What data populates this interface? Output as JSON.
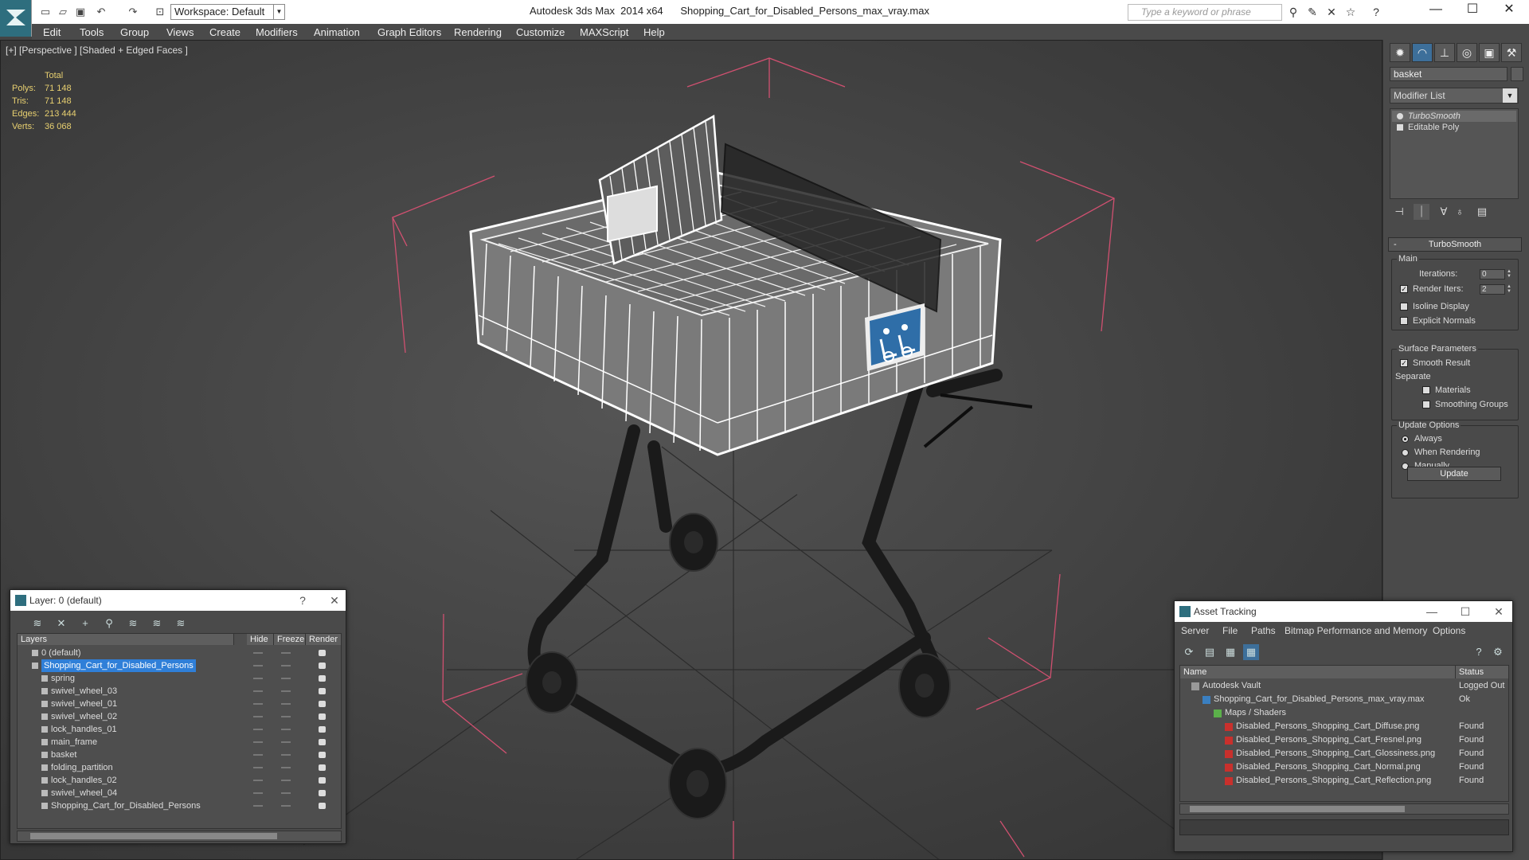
{
  "titlebar": {
    "app_title": "Autodesk 3ds Max  2014 x64",
    "file_name": "Shopping_Cart_for_Disabled_Persons_max_vray.max",
    "workspace": "Workspace: Default",
    "search_placeholder": "Type a keyword or phrase"
  },
  "menu": [
    "Edit",
    "Tools",
    "Group",
    "Views",
    "Create",
    "Modifiers",
    "Animation",
    "Graph Editors",
    "Rendering",
    "Customize",
    "MAXScript",
    "Help"
  ],
  "viewport": {
    "label": "[+] [Perspective ] [Shaded + Edged Faces ]",
    "stats": {
      "header": "Total",
      "rows": [
        {
          "key": "Polys:",
          "value": "71 148"
        },
        {
          "key": "Tris:",
          "value": "71 148"
        },
        {
          "key": "Edges:",
          "value": "213 444"
        },
        {
          "key": "Verts:",
          "value": "36 068"
        }
      ]
    }
  },
  "command_panel": {
    "object_name": "basket",
    "modifier_list": "Modifier List",
    "stack": [
      "TurboSmooth",
      "Editable Poly"
    ],
    "rollout_title": "TurboSmooth",
    "main_group": "Main",
    "iterations_label": "Iterations:",
    "iterations_value": "0",
    "render_iters_label": "Render Iters:",
    "render_iters_value": "2",
    "isoline_label": "Isoline Display",
    "explicit_normals_label": "Explicit Normals",
    "surface_group": "Surface Parameters",
    "smooth_result_label": "Smooth Result",
    "separate_label": "Separate",
    "materials_label": "Materials",
    "smoothing_groups_label": "Smoothing Groups",
    "update_group": "Update Options",
    "always_label": "Always",
    "when_rendering_label": "When Rendering",
    "manually_label": "Manually",
    "update_button": "Update"
  },
  "layer_window": {
    "title": "Layer: 0 (default)",
    "help": "?",
    "columns": [
      "Layers",
      "Hide",
      "Freeze",
      "Render"
    ],
    "rows": [
      {
        "name": "0 (default)",
        "level": 0,
        "selected": false
      },
      {
        "name": "Shopping_Cart_for_Disabled_Persons",
        "level": 0,
        "selected": true
      },
      {
        "name": "spring",
        "level": 1,
        "selected": false
      },
      {
        "name": "swivel_wheel_03",
        "level": 1,
        "selected": false
      },
      {
        "name": "swivel_wheel_01",
        "level": 1,
        "selected": false
      },
      {
        "name": "swivel_wheel_02",
        "level": 1,
        "selected": false
      },
      {
        "name": "lock_handles_01",
        "level": 1,
        "selected": false
      },
      {
        "name": "main_frame",
        "level": 1,
        "selected": false
      },
      {
        "name": "basket",
        "level": 1,
        "selected": false
      },
      {
        "name": "folding_partition",
        "level": 1,
        "selected": false
      },
      {
        "name": "lock_handles_02",
        "level": 1,
        "selected": false
      },
      {
        "name": "swivel_wheel_04",
        "level": 1,
        "selected": false
      },
      {
        "name": "Shopping_Cart_for_Disabled_Persons",
        "level": 1,
        "selected": false
      }
    ]
  },
  "asset_window": {
    "title": "Asset Tracking",
    "menu": [
      "Server",
      "File",
      "Paths",
      "Bitmap Performance and Memory",
      "Options"
    ],
    "columns": [
      "Name",
      "Status"
    ],
    "rows": [
      {
        "name": "Autodesk Vault",
        "status": "Logged Out",
        "level": 0,
        "icon": "vault"
      },
      {
        "name": "Shopping_Cart_for_Disabled_Persons_max_vray.max",
        "status": "Ok",
        "level": 1,
        "icon": "max"
      },
      {
        "name": "Maps / Shaders",
        "status": "",
        "level": 2,
        "icon": "folder"
      },
      {
        "name": "Disabled_Persons_Shopping_Cart_Diffuse.png",
        "status": "Found",
        "level": 3,
        "icon": "png"
      },
      {
        "name": "Disabled_Persons_Shopping_Cart_Fresnel.png",
        "status": "Found",
        "level": 3,
        "icon": "png"
      },
      {
        "name": "Disabled_Persons_Shopping_Cart_Glossiness.png",
        "status": "Found",
        "level": 3,
        "icon": "png"
      },
      {
        "name": "Disabled_Persons_Shopping_Cart_Normal.png",
        "status": "Found",
        "level": 3,
        "icon": "png"
      },
      {
        "name": "Disabled_Persons_Shopping_Cart_Reflection.png",
        "status": "Found",
        "level": 3,
        "icon": "png"
      }
    ]
  },
  "colors": {
    "accent": "#3d6f9a",
    "selection": "#2f7fd8",
    "stats": "#e8d070",
    "bbox": "#d05070"
  }
}
